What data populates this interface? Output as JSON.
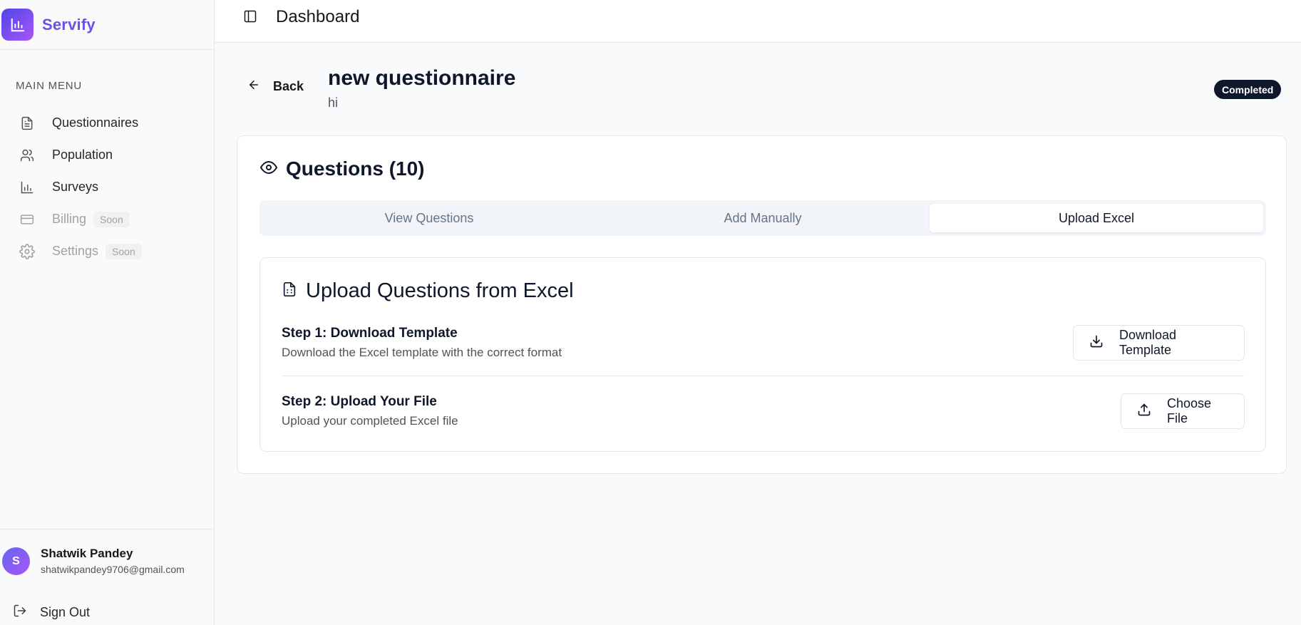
{
  "app": {
    "name": "Servify"
  },
  "sidebar": {
    "menu_title": "MAIN MENU",
    "items": [
      {
        "label": "Questionnaires",
        "icon": "file-text-icon"
      },
      {
        "label": "Population",
        "icon": "users-icon"
      },
      {
        "label": "Surveys",
        "icon": "bar-chart-icon"
      },
      {
        "label": "Billing",
        "icon": "credit-card-icon",
        "badge": "Soon"
      },
      {
        "label": "Settings",
        "icon": "gear-icon",
        "badge": "Soon"
      }
    ],
    "user": {
      "initial": "S",
      "name": "Shatwik Pandey",
      "email": "shatwikpandey9706@gmail.com"
    },
    "sign_out": "Sign Out"
  },
  "header": {
    "title": "Dashboard"
  },
  "questionnaire": {
    "back_label": "Back",
    "title": "new questionnaire",
    "description": "hi",
    "status": "Completed"
  },
  "questions_card": {
    "title": "Questions (10)",
    "tabs": [
      {
        "label": "View Questions",
        "active": false
      },
      {
        "label": "Add Manually",
        "active": false
      },
      {
        "label": "Upload Excel",
        "active": true
      }
    ]
  },
  "upload": {
    "title": "Upload Questions from Excel",
    "step1": {
      "title": "Step 1: Download Template",
      "desc": "Download the Excel template with the correct format",
      "button": "Download Template"
    },
    "step2": {
      "title": "Step 2: Upload Your File",
      "desc": "Upload your completed Excel file",
      "button": "Choose File"
    }
  },
  "colors": {
    "brand_gradient_start": "#4f46e5",
    "brand_gradient_end": "#a855f7",
    "badge_bg": "#0f172a"
  }
}
